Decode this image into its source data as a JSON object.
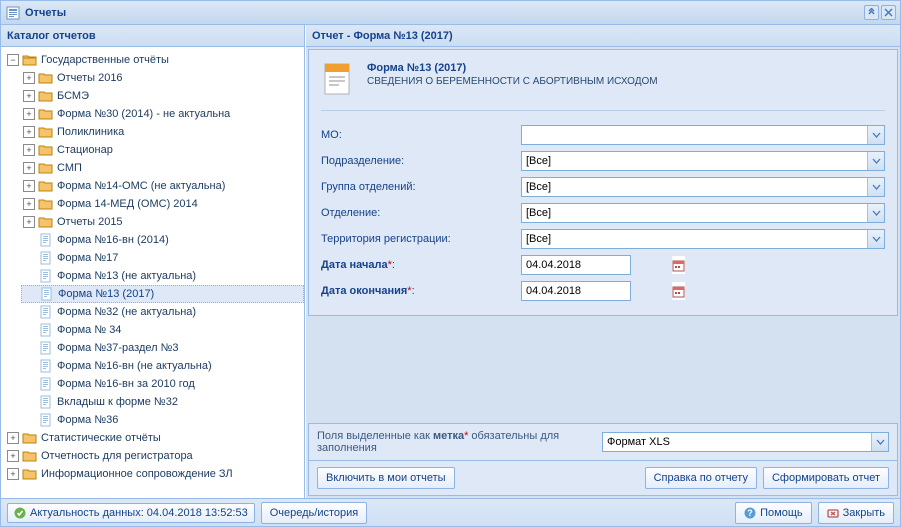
{
  "window": {
    "title": "Отчеты"
  },
  "catalog": {
    "header": "Каталог отчетов",
    "root": {
      "label": "Государственные отчёты",
      "children": [
        {
          "label": "Отчеты 2016",
          "type": "folder",
          "expandable": true
        },
        {
          "label": "БСМЭ",
          "type": "folder",
          "expandable": true
        },
        {
          "label": "Форма №30 (2014) - не актуальна",
          "type": "folder",
          "expandable": true
        },
        {
          "label": "Поликлиника",
          "type": "folder",
          "expandable": true
        },
        {
          "label": "Стационар",
          "type": "folder",
          "expandable": true
        },
        {
          "label": "СМП",
          "type": "folder",
          "expandable": true
        },
        {
          "label": "Форма №14-ОМС (не актуальна)",
          "type": "folder",
          "expandable": true
        },
        {
          "label": "Форма 14-МЕД (ОМС) 2014",
          "type": "folder",
          "expandable": true
        },
        {
          "label": "Отчеты 2015",
          "type": "folder",
          "expandable": true
        },
        {
          "label": "Форма №16-вн (2014)",
          "type": "doc"
        },
        {
          "label": "Форма №17",
          "type": "doc"
        },
        {
          "label": "Форма №13 (не актуальна)",
          "type": "doc"
        },
        {
          "label": "Форма №13 (2017)",
          "type": "doc",
          "selected": true
        },
        {
          "label": "Форма №32 (не актуальна)",
          "type": "doc"
        },
        {
          "label": "Форма № 34",
          "type": "doc"
        },
        {
          "label": "Форма №37-раздел №3",
          "type": "doc"
        },
        {
          "label": "Форма №16-вн (не актуальна)",
          "type": "doc"
        },
        {
          "label": "Форма №16-вн за 2010 год",
          "type": "doc"
        },
        {
          "label": "Вкладыш к форме №32",
          "type": "doc"
        },
        {
          "label": "Форма №36",
          "type": "doc"
        }
      ]
    },
    "siblings": [
      {
        "label": "Статистические отчёты"
      },
      {
        "label": "Отчетность для регистратора"
      },
      {
        "label": "Информационное сопровождение ЗЛ"
      }
    ]
  },
  "report": {
    "header": "Отчет - Форма №13 (2017)",
    "title": "Форма №13 (2017)",
    "subtitle": "СВЕДЕНИЯ О БЕРЕМЕННОСТИ С АБОРТИВНЫМ ИСХОДОМ",
    "fields": {
      "mo": {
        "label": "МО:",
        "value": ""
      },
      "unit": {
        "label": "Подразделение:",
        "value": "[Все]"
      },
      "deptgroup": {
        "label": "Группа отделений:",
        "value": "[Все]"
      },
      "dept": {
        "label": "Отделение:",
        "value": "[Все]"
      },
      "territory": {
        "label": "Территория регистрации:",
        "value": "[Все]"
      },
      "start": {
        "label": "Дата начала",
        "value": "04.04.2018"
      },
      "end": {
        "label": "Дата окончания",
        "value": "04.04.2018"
      }
    },
    "hint_prefix": "Поля выделенные как ",
    "hint_bold": "метка",
    "hint_suffix": " обязательны для заполнения",
    "format_value": "Формат XLS",
    "buttons": {
      "include": "Включить в мои отчеты",
      "reference": "Справка по отчету",
      "build": "Сформировать отчет"
    }
  },
  "statusbar": {
    "actuality": "Актуальность данных: 04.04.2018 13:52:53",
    "queue": "Очередь/история",
    "help": "Помощь",
    "close": "Закрыть"
  }
}
